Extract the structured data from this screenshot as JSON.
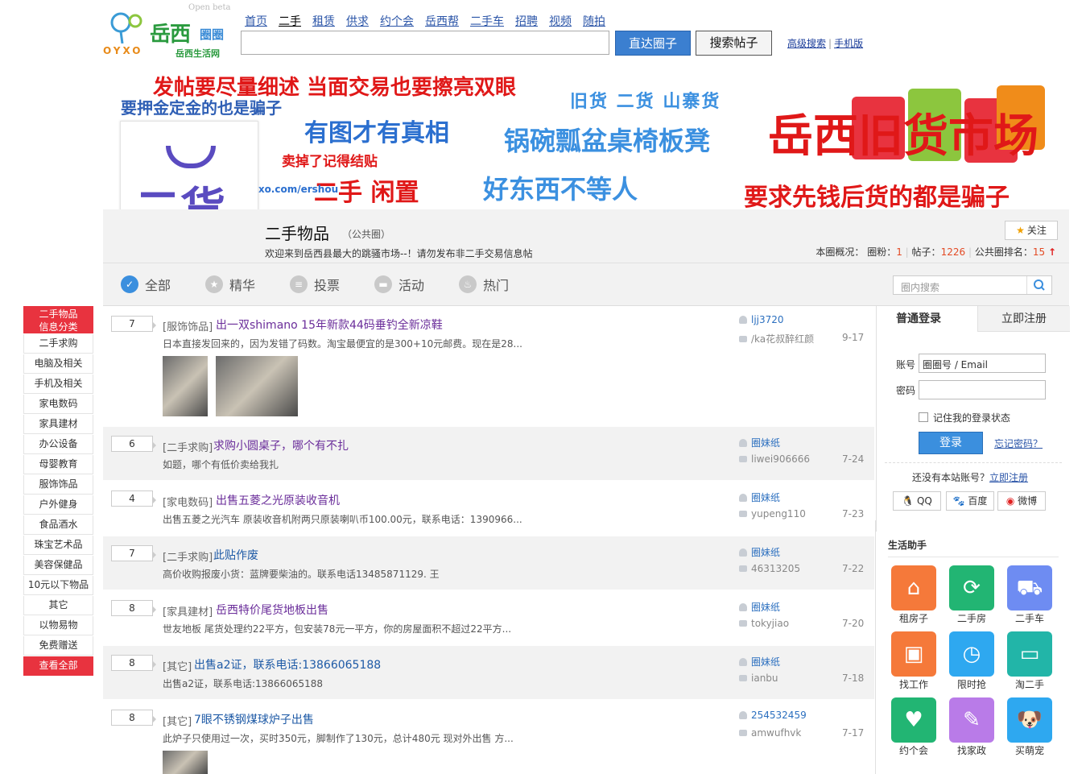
{
  "logo": {
    "beta": "Open beta",
    "brand": "岳西",
    "quan": "圈圈",
    "oyxo": "OYXO",
    "sub": "岳西生活网"
  },
  "topnav": [
    "首页",
    "二手",
    "租赁",
    "供求",
    "约个会",
    "岳西帮",
    "二手车",
    "招聘",
    "视频",
    "随拍"
  ],
  "search": {
    "go_label": "直达圈子",
    "search_label": "搜索帖子",
    "advanced": "高级搜索",
    "sep": "|",
    "mobile": "手机版"
  },
  "banner": {
    "line1": "发帖要尽量细述 当面交易也要擦亮双眼",
    "line2": "要押金定金的也是骗子",
    "line3": "有图才有真相",
    "line4": "卖掉了记得结贴",
    "line5": "二手  闲置",
    "url": "yxo.com/ershou",
    "line6": "旧货  二货  山寨货",
    "line7": "锅碗瓢盆桌椅板凳",
    "line8": "好东西不等人",
    "line9": "要求先钱后货的都是骗子",
    "big": "岳西旧货市场",
    "card_text": "二货"
  },
  "group": {
    "name": "二手物品",
    "type": "（公共圈）",
    "desc": "欢迎来到岳西县最大的跳骚市场--！请勿发布非二手交易信息帖",
    "follow": "关注",
    "stats_label": "本圈概况：",
    "fans_label": "圈粉：",
    "fans": "1",
    "posts_label": "帖子：",
    "posts": "1226",
    "rank_label": "公共圈排名：",
    "rank": "15"
  },
  "tabs": [
    "全部",
    "精华",
    "投票",
    "活动",
    "热门"
  ],
  "group_search_placeholder": "圈内搜索",
  "categories": [
    "二手求购",
    "电脑及相关",
    "手机及相关",
    "家电数码",
    "家具建材",
    "办公设备",
    "母婴教育",
    "服饰饰品",
    "户外健身",
    "食品酒水",
    "珠宝艺术品",
    "美容保健品",
    "10元以下物品",
    "其它",
    "以物易物",
    "免费赠送"
  ],
  "categories_head": [
    "二手物品",
    "信息分类"
  ],
  "categories_all": "查看全部",
  "threads": [
    {
      "count": "7",
      "cat": "[服饰饰品]",
      "title": "出一双shimano 15年新款44码垂钓全新凉鞋",
      "summary": "日本直接发回来的，因为发错了码数。淘宝最便宜的是300+10元邮费。现在是28...",
      "user": "ljj3720",
      "reply": "/ka花叔醉红颜",
      "date": "9-17"
    },
    {
      "count": "6",
      "cat": "[二手求购]",
      "title": "求购小圆桌子，哪个有不扎",
      "summary": "如题，哪个有低价卖给我扎",
      "user": "圈妹纸",
      "reply": "liwei906666",
      "date": "7-24"
    },
    {
      "count": "4",
      "cat": "[家电数码]",
      "title": "出售五菱之光原装收音机",
      "summary": "出售五菱之光汽车 原装收音机附两只原装喇叭币100.00元，联系电话：1390966...",
      "user": "圈妹纸",
      "reply": "yupeng110",
      "date": "7-23"
    },
    {
      "count": "7",
      "cat": "[二手求购]",
      "title": "此贴作废",
      "summary": "高价收购报废小货：蓝牌要柴油的。联系电话13485871129. 王",
      "user": "圈妹纸",
      "reply": "46313205",
      "date": "7-22"
    },
    {
      "count": "8",
      "cat": "[家具建材]",
      "title": "岳西特价尾货地板出售",
      "summary": "世友地板 尾货处理约22平方，包安装78元一平方，你的房屋面积不超过22平方...",
      "user": "圈妹纸",
      "reply": "tokyjiao",
      "date": "7-20"
    },
    {
      "count": "8",
      "cat": "[其它]",
      "title": "出售a2证，联系电话:13866065188",
      "summary": "出售a2证，联系电话:13866065188",
      "user": "圈妹纸",
      "reply": "ianbu",
      "date": "7-18"
    },
    {
      "count": "8",
      "cat": "[其它]",
      "title": "7眼不锈钢煤球炉子出售",
      "summary": "此炉子只使用过一次，买时350元，脚制作了130元，总计480元 现对外出售 方...",
      "user": "254532459",
      "reply": "amwufhvk",
      "date": "7-17"
    }
  ],
  "login": {
    "tab_login": "普通登录",
    "tab_register": "立即注册",
    "account_label": "账号",
    "account_value": "圈圈号 / Email",
    "password_label": "密码",
    "remember": "记住我的登录状态",
    "login_button": "登录",
    "forgot": "忘记密码？",
    "no_account": "还没有本站账号？",
    "register_link": "立即注册",
    "social": [
      "QQ",
      "百度",
      "微博"
    ]
  },
  "helper": {
    "title": "生活助手",
    "items": [
      {
        "label": "租房子",
        "color": "#f5793a",
        "icon": "house-icon"
      },
      {
        "label": "二手房",
        "color": "#22b573",
        "icon": "refresh-house-icon"
      },
      {
        "label": "二手车",
        "color": "#6e8cf2",
        "icon": "car-icon"
      },
      {
        "label": "找工作",
        "color": "#f5793a",
        "icon": "briefcase-icon"
      },
      {
        "label": "限时抢",
        "color": "#2ea8f0",
        "icon": "clock-icon"
      },
      {
        "label": "淘二手",
        "color": "#22b5a8",
        "icon": "monitor-icon"
      },
      {
        "label": "约个会",
        "color": "#22b573",
        "icon": "people-icon"
      },
      {
        "label": "找家政",
        "color": "#b97be8",
        "icon": "broom-icon"
      },
      {
        "label": "买萌宠",
        "color": "#2ea8f0",
        "icon": "dog-icon"
      }
    ]
  }
}
